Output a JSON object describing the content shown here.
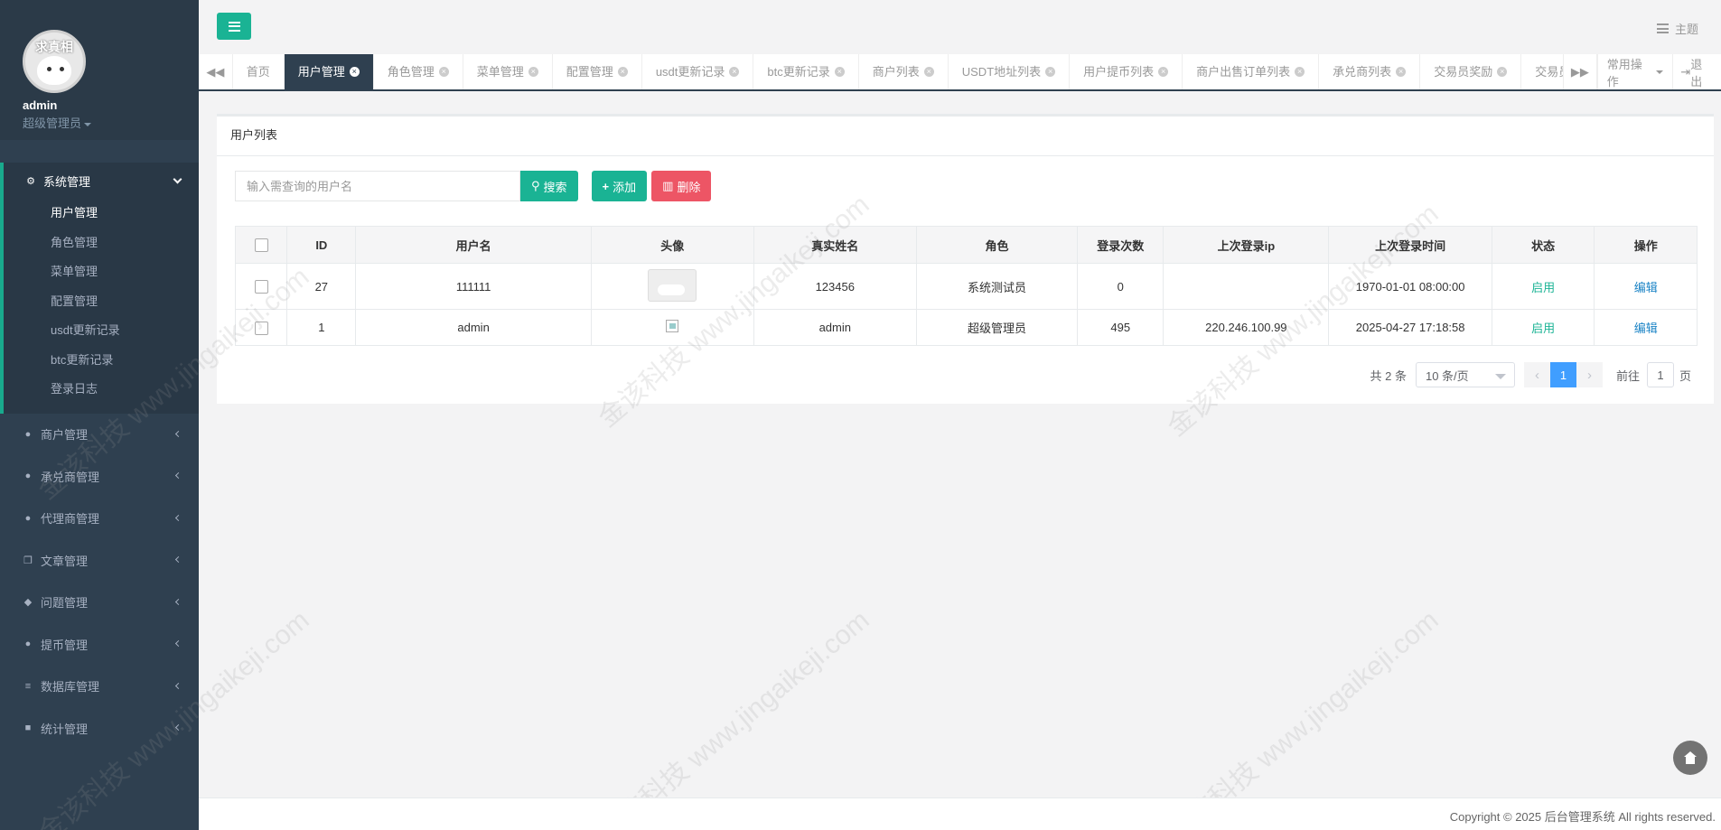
{
  "colors": {
    "sidebar_bg": "#2f4050",
    "accent": "#1ab394",
    "danger": "#ed5565",
    "link": "#1c84c6",
    "pager_active": "#409eff"
  },
  "profile": {
    "avatar_text": "求真相",
    "name": "admin",
    "role": "超级管理员"
  },
  "sidebar": {
    "active_group": {
      "label": "系统管理",
      "icon": "gear-icon",
      "items": [
        {
          "label": "用户管理",
          "active": true
        },
        {
          "label": "角色管理"
        },
        {
          "label": "菜单管理"
        },
        {
          "label": "配置管理"
        },
        {
          "label": "usdt更新记录"
        },
        {
          "label": "btc更新记录"
        },
        {
          "label": "登录日志"
        }
      ]
    },
    "groups": [
      {
        "label": "商户管理",
        "icon": "user-icon"
      },
      {
        "label": "承兑商管理",
        "icon": "user-icon"
      },
      {
        "label": "代理商管理",
        "icon": "user-icon"
      },
      {
        "label": "文章管理",
        "icon": "copy-icon"
      },
      {
        "label": "问题管理",
        "icon": "comment-icon"
      },
      {
        "label": "提币管理",
        "icon": "user-icon"
      },
      {
        "label": "数据库管理",
        "icon": "database-icon"
      },
      {
        "label": "统计管理",
        "icon": "cube-icon"
      }
    ]
  },
  "topbar": {
    "theme_label": "主题"
  },
  "tabs": {
    "items": [
      {
        "label": "首页",
        "closable": false
      },
      {
        "label": "用户管理",
        "active": true
      },
      {
        "label": "角色管理"
      },
      {
        "label": "菜单管理"
      },
      {
        "label": "配置管理"
      },
      {
        "label": "usdt更新记录"
      },
      {
        "label": "btc更新记录"
      },
      {
        "label": "商户列表"
      },
      {
        "label": "USDT地址列表"
      },
      {
        "label": "用户提币列表"
      },
      {
        "label": "商户出售订单列表"
      },
      {
        "label": "承兑商列表"
      },
      {
        "label": "交易员奖励"
      },
      {
        "label": "交易员充"
      }
    ],
    "ops_label": "常用操作",
    "logout_label": "退出"
  },
  "panel": {
    "title": "用户列表",
    "search_placeholder": "输入需查询的用户名",
    "search_label": "搜索",
    "add_label": "添加",
    "delete_label": "删除"
  },
  "table": {
    "columns": [
      "ID",
      "用户名",
      "头像",
      "真实姓名",
      "角色",
      "登录次数",
      "上次登录ip",
      "上次登录时间",
      "状态",
      "操作"
    ],
    "rows": [
      {
        "id": "27",
        "username": "111111",
        "real_name": "123456",
        "role": "系统测试员",
        "login_count": "0",
        "last_ip": "",
        "last_time": "1970-01-01 08:00:00",
        "status": "启用",
        "action": "编辑"
      },
      {
        "id": "1",
        "username": "admin",
        "real_name": "admin",
        "role": "超级管理员",
        "login_count": "495",
        "last_ip": "220.246.100.99",
        "last_time": "2025-04-27 17:18:58",
        "status": "启用",
        "action": "编辑"
      }
    ]
  },
  "pager": {
    "total_text": "共 2 条",
    "page_size": "10 条/页",
    "current_page": "1",
    "goto_label": "前往",
    "goto_value": "1",
    "page_suffix": "页"
  },
  "footer": {
    "copyright": "Copyright © 2025 后台管理系统 All rights reserved."
  },
  "watermark_text": "金该科技 www.jingaikeji.com"
}
